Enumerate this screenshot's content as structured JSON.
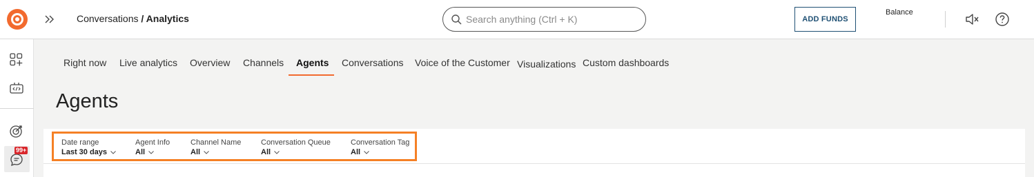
{
  "header": {
    "breadcrumb_parent": "Conversations",
    "breadcrumb_separator": " / ",
    "breadcrumb_current": "Analytics",
    "search_placeholder": "Search anything (Ctrl + K)",
    "add_funds_label": "ADD FUNDS",
    "balance_label": "Balance"
  },
  "rail": {
    "notification_badge": "99+"
  },
  "tabs": [
    {
      "label": "Right now"
    },
    {
      "label": "Live analytics"
    },
    {
      "label": "Overview"
    },
    {
      "label": "Channels"
    },
    {
      "label": "Agents",
      "active": true
    },
    {
      "label": "Conversations"
    },
    {
      "label": "Voice of the Customer"
    },
    {
      "label": "Visualizations"
    },
    {
      "label": "Custom dashboards"
    }
  ],
  "page_title": "Agents",
  "filters": [
    {
      "label": "Date range",
      "value": "Last 30 days"
    },
    {
      "label": "Agent Info",
      "value": "All"
    },
    {
      "label": "Channel Name",
      "value": "All"
    },
    {
      "label": "Conversation Queue",
      "value": "All"
    },
    {
      "label": "Conversation Tag",
      "value": "All"
    }
  ],
  "colors": {
    "brand": "#f26a2e",
    "highlight_border": "#f58025",
    "button_text": "#1e4f73",
    "badge": "#d9262b"
  },
  "icons": {
    "logo": "brand-logo-icon",
    "expand": "double-chevron-right-icon",
    "search": "search-icon",
    "mute": "speaker-muted-icon",
    "help": "help-circle-icon",
    "apps": "add-apps-icon",
    "developer": "code-bot-icon",
    "goals": "target-icon",
    "chat": "chat-bubble-icon"
  }
}
